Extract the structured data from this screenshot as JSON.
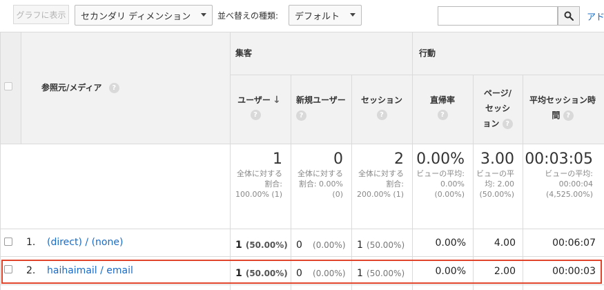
{
  "toolbar": {
    "chart_button": "グラフに表示",
    "secondary_dimension": "セカンダリ ディメンション",
    "sort_label": "並べ替えの種類:",
    "sort_value": "デフォルト",
    "search_placeholder": "",
    "advanced_link": "アド"
  },
  "table": {
    "dimension_header": "参照元/メディア",
    "group_acquisition": "集客",
    "group_behavior": "行動",
    "columns": {
      "users": "ユーザー",
      "new_users": "新規ユーザー",
      "sessions": "セッション",
      "bounce": "直帰率",
      "pages": "ページ/セッション",
      "duration": "平均セッション時間"
    },
    "totals": {
      "users": {
        "value": "1",
        "sub": "全体に対する割合: 100.00% (1)"
      },
      "new_users": {
        "value": "0",
        "sub": "全体に対する割合: 0.00% (0)"
      },
      "sessions": {
        "value": "2",
        "sub": "全体に対する割合: 200.00% (1)"
      },
      "bounce": {
        "value": "0.00%",
        "sub": "ビューの平均: 0.00% (0.00%)"
      },
      "pages": {
        "value": "3.00",
        "sub": "ビューの平均: 2.00 (50.00%)"
      },
      "duration": {
        "value": "00:03:05",
        "sub": "ビューの平均: 00:00:04 (4,525.00%)"
      }
    },
    "rows": [
      {
        "index": "1.",
        "source": "(direct) / (none)",
        "users": "1",
        "users_pct": "(50.00%)",
        "new_users": "0",
        "new_users_pct": "(0.00%)",
        "sessions": "1",
        "sessions_pct": "(50.00%)",
        "bounce": "0.00%",
        "pages": "4.00",
        "duration": "00:06:07"
      },
      {
        "index": "2.",
        "source": "haihaimail / email",
        "users": "1",
        "users_pct": "(50.00%)",
        "new_users": "0",
        "new_users_pct": "(0.00%)",
        "sessions": "1",
        "sessions_pct": "(50.00%)",
        "bounce": "0.00%",
        "pages": "2.00",
        "duration": "00:00:03"
      }
    ]
  },
  "help_glyph": "?",
  "sort_arrow": "↓",
  "colors": {
    "link": "#1a6bc5",
    "highlight": "#e0452b",
    "header_bg": "#f2f2f2"
  }
}
